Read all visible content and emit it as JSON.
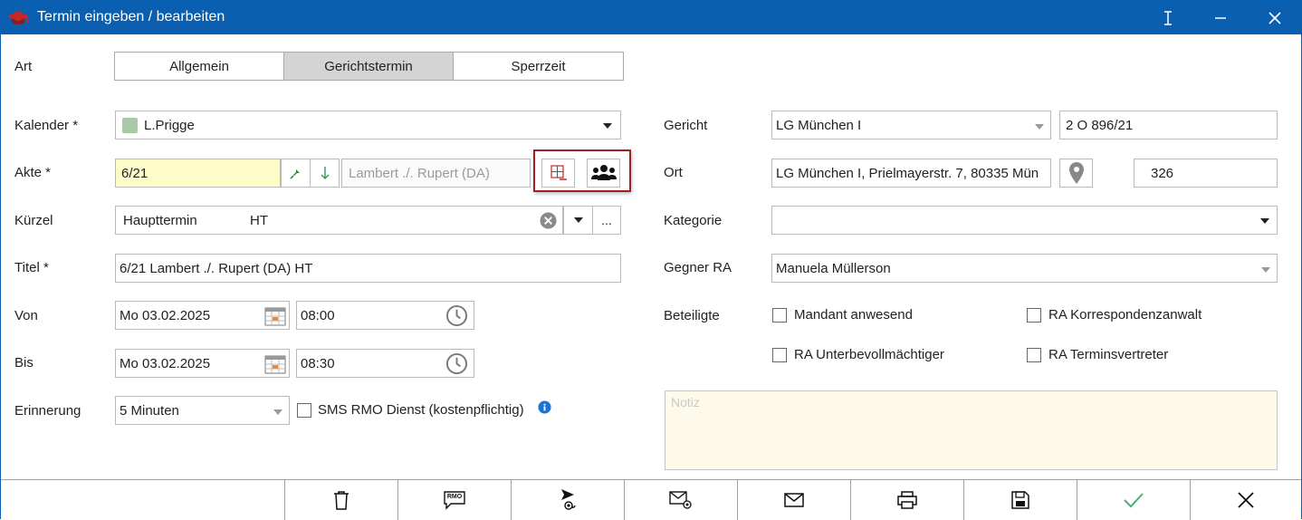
{
  "window": {
    "title": "Termin eingeben / bearbeiten"
  },
  "art": {
    "label": "Art",
    "tabs": [
      {
        "label": "Allgemein",
        "active": false
      },
      {
        "label": "Gerichtstermin",
        "active": true
      },
      {
        "label": "Sperrzeit",
        "active": false
      }
    ]
  },
  "left": {
    "kalender": {
      "label": "Kalender *",
      "value": "L.Prigge",
      "color": "#a9c9a6"
    },
    "akte": {
      "label": "Akte *",
      "value": "6/21",
      "parties_placeholder": "Lambert ./. Rupert (DA)"
    },
    "kuerzel": {
      "label": "Kürzel",
      "value": "Haupttermin",
      "code": "HT",
      "more": "..."
    },
    "titel": {
      "label": "Titel *",
      "value": "6/21 Lambert ./. Rupert (DA) HT"
    },
    "von": {
      "label": "Von",
      "date": "Mo 03.02.2025",
      "time": "08:00"
    },
    "bis": {
      "label": "Bis",
      "date": "Mo 03.02.2025",
      "time": "08:30"
    },
    "erinnerung": {
      "label": "Erinnerung",
      "value": "5 Minuten",
      "sms_label": "SMS RMO Dienst (kostenpflichtig)"
    }
  },
  "right": {
    "gericht": {
      "label": "Gericht",
      "value": "LG München I",
      "aktenzeichen": "2 O 896/21"
    },
    "ort": {
      "label": "Ort",
      "value": "LG München I, Prielmayerstr. 7, 80335 Mün",
      "room": "326"
    },
    "kategorie": {
      "label": "Kategorie",
      "value": ""
    },
    "gegner_ra": {
      "label": "Gegner RA",
      "value": "Manuela Müllerson"
    },
    "beteiligte": {
      "label": "Beteiligte",
      "options": [
        "Mandant anwesend",
        "RA Korrespondenzanwalt",
        "RA Unterbevollmächtiger",
        "RA Terminsvertreter"
      ]
    },
    "notiz": {
      "placeholder": "Notiz"
    }
  },
  "toolbar": {
    "sms_badge": "RMO",
    "icons": [
      "trash-icon",
      "sms-icon",
      "send-at-icon",
      "mail-at-icon",
      "mail-icon",
      "print-icon",
      "save-icon",
      "check-icon",
      "close-icon"
    ]
  },
  "colors": {
    "titlebar": "#0a5fb0",
    "akte_highlight": "#fdfcc9",
    "notiz_bg": "#fdfaea",
    "highlight_border": "#a42020",
    "check_green": "#4caf72",
    "info_blue": "#1a73d9"
  }
}
